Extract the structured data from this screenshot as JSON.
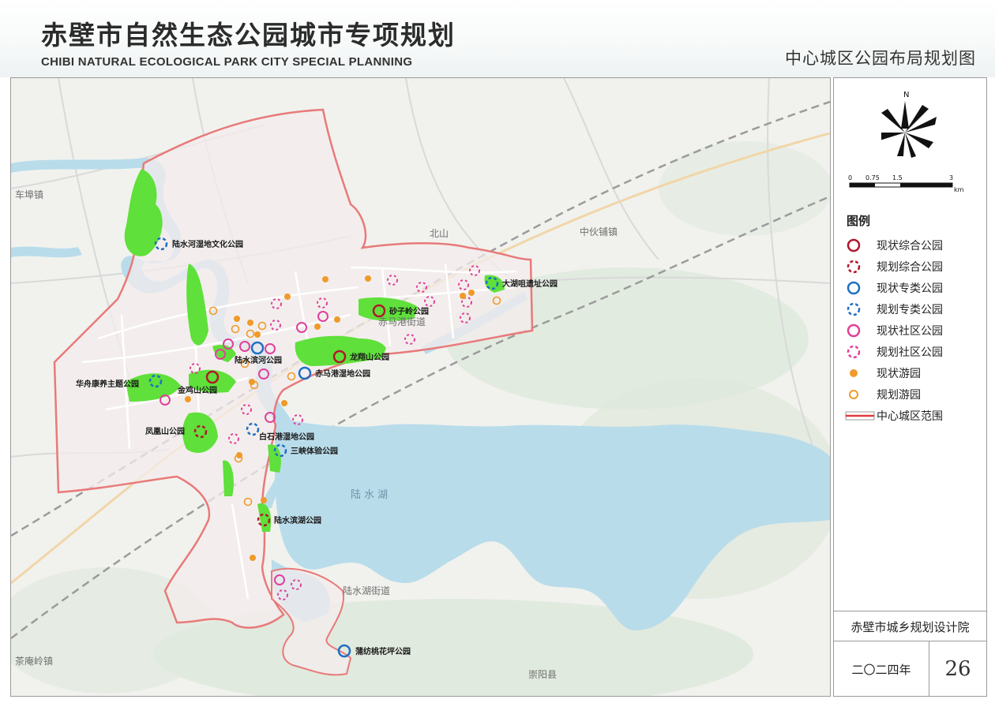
{
  "header": {
    "title_cn": "赤壁市自然生态公园城市专项规划",
    "title_en": "CHIBI NATURAL ECOLOGICAL PARK CITY SPECIAL PLANNING",
    "map_title": "中心城区公园布局规划图"
  },
  "compass": {
    "label": "N"
  },
  "scale_bar": {
    "ticks": [
      "0",
      "0.75",
      "1.5",
      "3"
    ],
    "unit": "km"
  },
  "legend": {
    "title": "图例",
    "items": [
      {
        "label": "现状综合公园",
        "color": "#b0172a",
        "style": "solid"
      },
      {
        "label": "规划综合公园",
        "color": "#b0172a",
        "style": "dashed"
      },
      {
        "label": "现状专类公园",
        "color": "#1f6fc2",
        "style": "solid"
      },
      {
        "label": "规划专类公园",
        "color": "#1f6fc2",
        "style": "dashed"
      },
      {
        "label": "现状社区公园",
        "color": "#e0409a",
        "style": "solid"
      },
      {
        "label": "规划社区公园",
        "color": "#e0409a",
        "style": "dashed"
      },
      {
        "label": "现状游园",
        "color": "#f09a2a",
        "style": "filled"
      },
      {
        "label": "规划游园",
        "color": "#f09a2a",
        "style": "ring"
      },
      {
        "label": "中心城区范围",
        "color": "#e03a3a",
        "style": "line"
      }
    ]
  },
  "colors": {
    "green": "#5fe03a",
    "water": "#b9dcea",
    "boundary": "#e87a7a",
    "urban": "#f6eeee"
  },
  "map": {
    "water_label": "陆水湖",
    "places": [
      "车埠镇",
      "中伙铺镇",
      "赤马港街道",
      "陆水湖街道",
      "茶庵岭镇",
      "崇阳县",
      "北山"
    ],
    "parks": [
      {
        "name": "陆水河湿地文化公园",
        "type": "planned-special"
      },
      {
        "name": "大湖咀遗址公园",
        "type": "planned-special"
      },
      {
        "name": "砂子岭公园",
        "type": "existing-comprehensive"
      },
      {
        "name": "龙翔山公园",
        "type": "existing-comprehensive"
      },
      {
        "name": "陆水滨河公园",
        "type": "existing-special"
      },
      {
        "name": "赤马港湿地公园",
        "type": "existing-special"
      },
      {
        "name": "华舟康养主题公园",
        "type": "planned-special"
      },
      {
        "name": "金鸡山公园",
        "type": "existing-comprehensive"
      },
      {
        "name": "凤凰山公园",
        "type": "planned-comprehensive"
      },
      {
        "name": "白石港湿地公园",
        "type": "planned-special"
      },
      {
        "name": "三峡体验公园",
        "type": "planned-special"
      },
      {
        "name": "陆水滨湖公园",
        "type": "planned-comprehensive"
      },
      {
        "name": "蒲纺桃花坪公园",
        "type": "existing-special"
      }
    ]
  },
  "footer": {
    "org": "赤壁市城乡规划设计院",
    "year": "二〇二四年",
    "page": "26"
  }
}
